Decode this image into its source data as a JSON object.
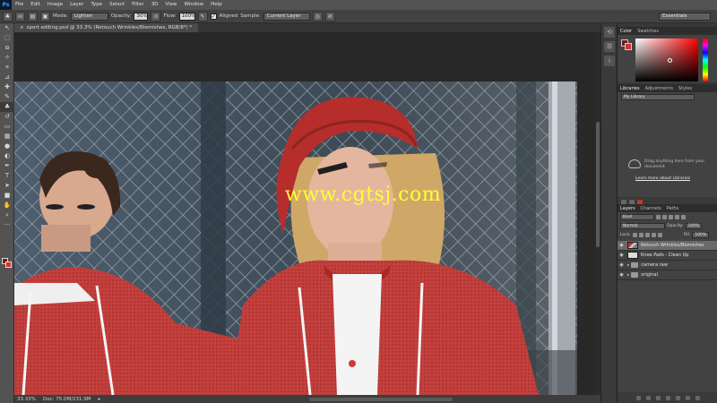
{
  "app": {
    "logo": "Ps"
  },
  "menu": [
    "File",
    "Edit",
    "Image",
    "Layer",
    "Type",
    "Select",
    "Filter",
    "3D",
    "View",
    "Window",
    "Help"
  ],
  "options_bar": {
    "brush_size": "40",
    "mode_label": "Mode:",
    "mode_value": "Lighten",
    "opacity_label": "Opacity:",
    "opacity_value": "30%",
    "flow_label": "Flow:",
    "flow_value": "100%",
    "aligned_label": "Aligned",
    "sample_label": "Sample:",
    "sample_value": "Current Layer",
    "workspace": "Essentials"
  },
  "document": {
    "tab_title": "sport editing.psd @ 33.3% (Retouch Wrinkles/Blemishes, RGB/8*) *",
    "watermark": "www.cgtsj.com",
    "zoom": "33.33%",
    "doc_info": "Doc: 75.0M/231.9M"
  },
  "color_panel": {
    "tabs": [
      "Color",
      "Swatches"
    ]
  },
  "libraries_panel": {
    "tabs": [
      "Libraries",
      "Adjustments",
      "Styles"
    ],
    "library": "My Library",
    "hint": "Drag anything here from your document",
    "link": "Learn more about Libraries"
  },
  "layers_panel": {
    "tabs": [
      "Layers",
      "Channels",
      "Paths"
    ],
    "kind": "Kind",
    "blend_mode": "Normal",
    "opacity_label": "Opacity:",
    "opacity_value": "100%",
    "lock_label": "Lock:",
    "fill_label": "Fill:",
    "fill_value": "100%",
    "layers": [
      {
        "name": "Retouch Wrinkles/Blemishes",
        "type": "pixel",
        "selected": true
      },
      {
        "name": "Knee Pads - Clean Up",
        "type": "empty",
        "selected": false
      },
      {
        "name": "camera raw",
        "type": "group",
        "selected": false
      },
      {
        "name": "original",
        "type": "group",
        "selected": false
      }
    ]
  },
  "colors": {
    "foreground": "#6e1c1c",
    "background": "#d8322d",
    "jersey_red": "#c8403e"
  }
}
